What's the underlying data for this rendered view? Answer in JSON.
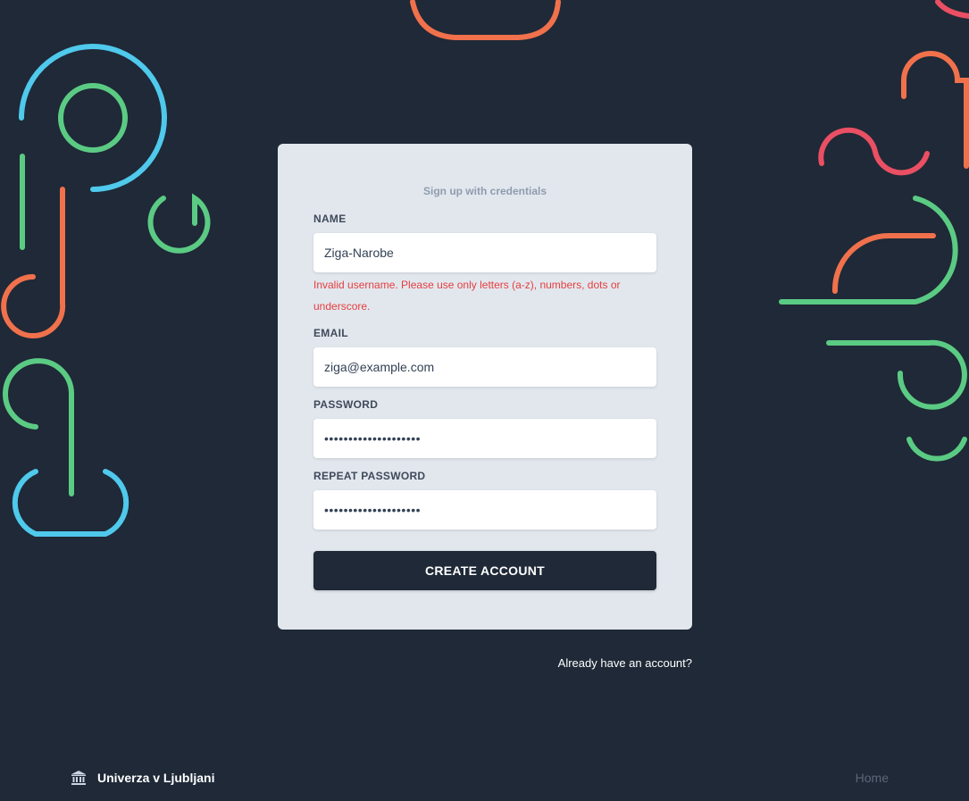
{
  "signup": {
    "title": "Sign up with credentials",
    "name": {
      "label": "NAME",
      "value": "Ziga-Narobe"
    },
    "name_error": "Invalid username. Please use only letters (a-z), numbers, dots or underscore.",
    "email": {
      "label": "EMAIL",
      "value": "ziga@example.com"
    },
    "password": {
      "label": "PASSWORD",
      "value": "••••••••••••••••••••"
    },
    "repeat_password": {
      "label": "REPEAT PASSWORD",
      "value": "••••••••••••••••••••"
    },
    "submit_label": "CREATE ACCOUNT"
  },
  "signin_link": "Already have an account?",
  "footer": {
    "brand_icon": "institution-icon",
    "brand_label": "Univerza v Ljubljani",
    "home_link": "Home"
  },
  "colors": {
    "background": "#1f2937",
    "card": "#e2e7ee",
    "error": "#e53e3e",
    "deco_blue": "#4fc9ec",
    "deco_green": "#5bcb84",
    "deco_orange": "#f0714c",
    "deco_red": "#ea4f63"
  }
}
